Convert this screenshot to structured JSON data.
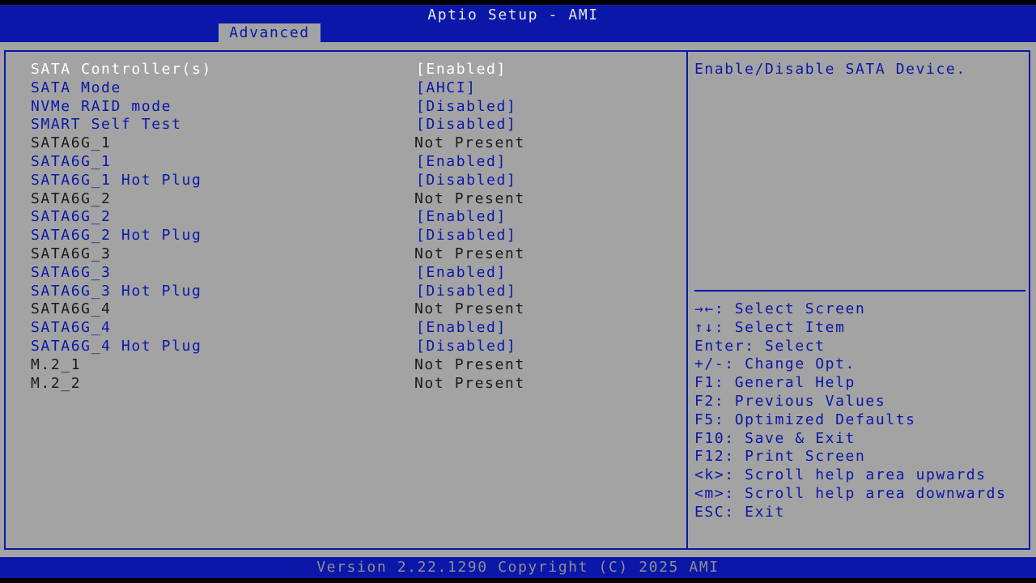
{
  "header": {
    "title": "Aptio Setup - AMI",
    "active_tab": "Advanced"
  },
  "settings": [
    {
      "label": "SATA Controller(s)",
      "value": "[Enabled]",
      "kind": "selected"
    },
    {
      "label": "SATA Mode",
      "value": "[AHCI]",
      "kind": "editable"
    },
    {
      "label": "NVMe RAID mode",
      "value": "[Disabled]",
      "kind": "editable"
    },
    {
      "label": "SMART Self Test",
      "value": "[Disabled]",
      "kind": "editable"
    },
    {
      "label": "SATA6G_1",
      "value": "Not Present",
      "kind": "info"
    },
    {
      "label": "SATA6G_1",
      "value": "[Enabled]",
      "kind": "editable"
    },
    {
      "label": "SATA6G_1 Hot Plug",
      "value": "[Disabled]",
      "kind": "editable"
    },
    {
      "label": "SATA6G_2",
      "value": "Not Present",
      "kind": "info"
    },
    {
      "label": "SATA6G_2",
      "value": "[Enabled]",
      "kind": "editable"
    },
    {
      "label": "SATA6G_2 Hot Plug",
      "value": "[Disabled]",
      "kind": "editable"
    },
    {
      "label": "SATA6G_3",
      "value": "Not Present",
      "kind": "info"
    },
    {
      "label": "SATA6G_3",
      "value": "[Enabled]",
      "kind": "editable"
    },
    {
      "label": "SATA6G_3 Hot Plug",
      "value": "[Disabled]",
      "kind": "editable"
    },
    {
      "label": "SATA6G_4",
      "value": "Not Present",
      "kind": "info"
    },
    {
      "label": "SATA6G_4",
      "value": "[Enabled]",
      "kind": "editable"
    },
    {
      "label": "SATA6G_4 Hot Plug",
      "value": "[Disabled]",
      "kind": "editable"
    },
    {
      "label": "M.2_1",
      "value": "Not Present",
      "kind": "info"
    },
    {
      "label": "M.2_2",
      "value": "Not Present",
      "kind": "info"
    }
  ],
  "help": {
    "text": "Enable/Disable SATA Device."
  },
  "keys": [
    "→←: Select Screen",
    "↑↓: Select Item",
    "Enter: Select",
    "+/-: Change Opt.",
    "F1: General Help",
    "F2: Previous Values",
    "F5: Optimized Defaults",
    "F10: Save & Exit",
    "F12: Print Screen",
    "<k>: Scroll help area upwards",
    "<m>: Scroll help area downwards",
    "ESC: Exit"
  ],
  "footer": {
    "version": "Version 2.22.1290 Copyright (C) 2025 AMI"
  },
  "colors": {
    "bios_blue": "#0a17a8",
    "panel_gray": "#a3a3a3",
    "selected_white": "#ffffff",
    "info_dark": "#1a1a1a"
  }
}
